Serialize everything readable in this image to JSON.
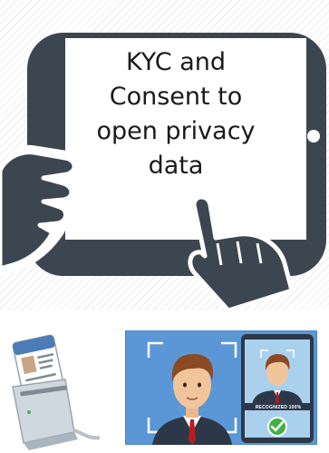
{
  "caption": {
    "text": "KYC and\nConsent to\nopen privacy\ndata"
  },
  "face_scan": {
    "badge": "RECOGNIZED 100%"
  },
  "icons": [
    "tablet-icon",
    "pointing-hand-icon",
    "id-card-reader-icon",
    "face-recognition-icon",
    "checkmark-icon"
  ],
  "colors": {
    "tablet": "#3c4651",
    "scan_bg": "#5b97d6",
    "phone_bg": "#a9d1ee",
    "check": "#43b047",
    "tie": "#b81d22",
    "suit": "#2c3848"
  }
}
